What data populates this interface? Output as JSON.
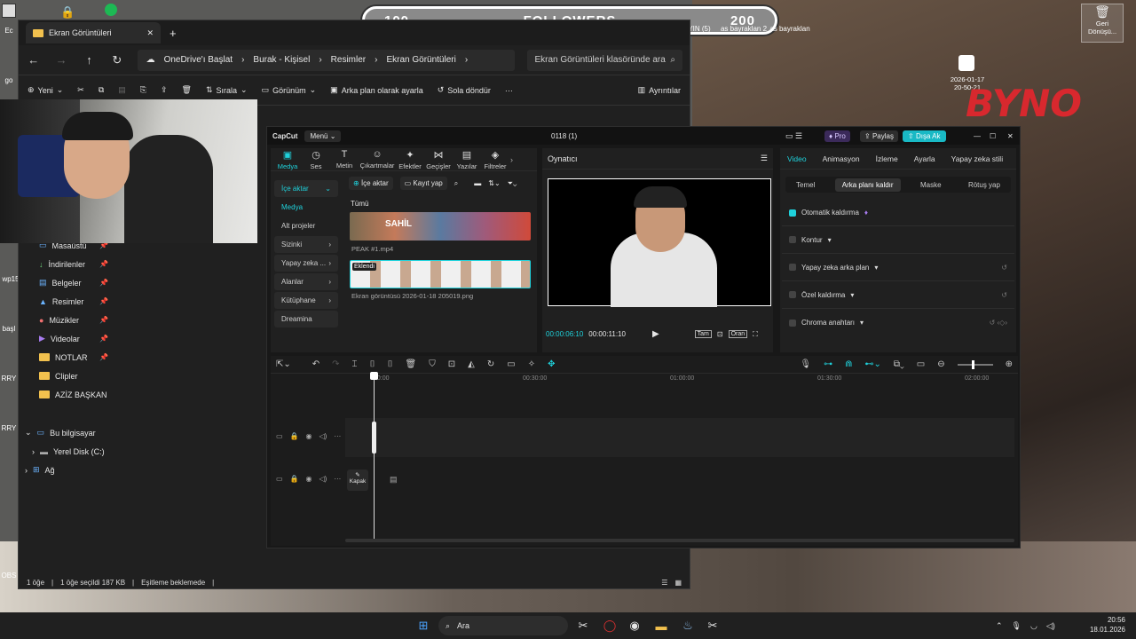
{
  "desktop": {
    "followers": {
      "left": "100",
      "label": "FOLLOWERS",
      "right": "200"
    },
    "top_icons": [
      "YIN (5)",
      "as bayraklan 2",
      "as bayraklan"
    ],
    "recycle_label": "Geri Dönüşü...",
    "clock_icon_text": [
      "2026-01-17",
      "20-50-21"
    ],
    "logo_text": "BYNO",
    "left_edge_labels": [
      "Ec",
      "go",
      "wp15",
      "başl",
      "RRY",
      "RRY",
      "OBS"
    ]
  },
  "explorer": {
    "tab_title": "Ekran Görüntüleri",
    "breadcrumbs": [
      "OneDrive'ı Başlat",
      "Burak - Kişisel",
      "Resimler",
      "Ekran Görüntüleri"
    ],
    "search_placeholder": "Ekran Görüntüleri klasöründe ara",
    "commands": {
      "new": "Yeni",
      "sort": "Sırala",
      "view": "Görünüm",
      "set_bg": "Arka plan olarak ayarla",
      "rotate_left": "Sola döndür",
      "details": "Ayrıntılar"
    },
    "nav_items": [
      {
        "label": "Masaüstü",
        "pinned": true
      },
      {
        "label": "İndirilenler",
        "pinned": true
      },
      {
        "label": "Belgeler",
        "pinned": true
      },
      {
        "label": "Resimler",
        "pinned": true
      },
      {
        "label": "Müzikler",
        "pinned": true
      },
      {
        "label": "Videolar",
        "pinned": true
      },
      {
        "label": "NOTLAR",
        "pinned": true
      },
      {
        "label": "Clipler",
        "pinned": false
      },
      {
        "label": "AZİZ BAŞKAN",
        "pinned": false
      }
    ],
    "tree": [
      "Bu bilgisayar",
      "Yerel Disk (C:)",
      "Ağ"
    ],
    "status": [
      "1 öğe",
      "1 öğe seçildi  187 KB",
      "Eşitleme beklemede"
    ]
  },
  "capcut": {
    "logo": "CapCut",
    "menu": "Menü",
    "project": "0118 (1)",
    "pro": "Pro",
    "share": "Paylaş",
    "export": "Dışa Ak",
    "tools": [
      {
        "label": "Medya",
        "icon": "▣",
        "active": true
      },
      {
        "label": "Ses",
        "icon": "◷",
        "active": false
      },
      {
        "label": "Metin",
        "icon": "T",
        "active": false
      },
      {
        "label": "Çıkartmalar",
        "icon": "☺",
        "active": false
      },
      {
        "label": "Efektler",
        "icon": "✦",
        "active": false
      },
      {
        "label": "Geçişler",
        "icon": "⋈",
        "active": false
      },
      {
        "label": "Yazılar",
        "icon": "▤",
        "active": false
      },
      {
        "label": "Filtreler",
        "icon": "◈",
        "active": false
      }
    ],
    "side_cats": [
      {
        "label": "İçe aktar",
        "arrow": "⌄",
        "bg": true,
        "active": true
      },
      {
        "label": "Medya",
        "arrow": "",
        "bg": false,
        "active": true
      },
      {
        "label": "Alt projeler",
        "arrow": "",
        "bg": false,
        "active": false
      },
      {
        "label": "Sizinki",
        "arrow": "›",
        "bg": true,
        "active": false
      },
      {
        "label": "Yapay zeka ...",
        "arrow": "›",
        "bg": true,
        "active": false
      },
      {
        "label": "Alanlar",
        "arrow": "›",
        "bg": true,
        "active": false
      },
      {
        "label": "Kütüphane",
        "arrow": "›",
        "bg": true,
        "active": false
      },
      {
        "label": "Dreamina",
        "arrow": "",
        "bg": true,
        "active": false
      }
    ],
    "media_toolbar": {
      "import": "İçe aktar",
      "record": "Kayıt yap"
    },
    "media_filter": "Tümü",
    "clip1": {
      "name": "PEAK #1.mp4",
      "overlay": "SAHİL"
    },
    "clip2": {
      "name": "Ekran görüntüsü 2026-01-18 205019.png",
      "badge": "Eklendi"
    },
    "player": {
      "title": "Oynatıcı",
      "current": "00:00:06:10",
      "total": "00:00:11:10",
      "full": "Tam",
      "ratio": "Oran"
    },
    "inspector": {
      "tabs": [
        {
          "label": "Video",
          "active": true
        },
        {
          "label": "Animasyon",
          "active": false
        },
        {
          "label": "İzleme",
          "active": false
        },
        {
          "label": "Ayarla",
          "active": false
        },
        {
          "label": "Yapay zeka stili",
          "active": false
        }
      ],
      "subtabs": [
        {
          "label": "Temel",
          "active": false
        },
        {
          "label": "Arka planı kaldır",
          "active": true
        },
        {
          "label": "Maske",
          "active": false
        },
        {
          "label": "Rötuş yap",
          "active": false
        }
      ],
      "options": [
        {
          "label": "Otomatik kaldırma",
          "on": true
        },
        {
          "label": "Kontur",
          "on": false
        },
        {
          "label": "Yapay zeka arka plan",
          "on": false
        },
        {
          "label": "Özel kaldırma",
          "on": false
        },
        {
          "label": "Chroma anahtarı",
          "on": false
        }
      ]
    },
    "timeline": {
      "ruler": [
        "00:00",
        "00:30:00",
        "01:00:00",
        "01:30:00",
        "02:00:00"
      ],
      "cover": "Kapak"
    }
  },
  "taskbar": {
    "search": "Ara",
    "time": "20:56",
    "date": "18.01.2026"
  }
}
